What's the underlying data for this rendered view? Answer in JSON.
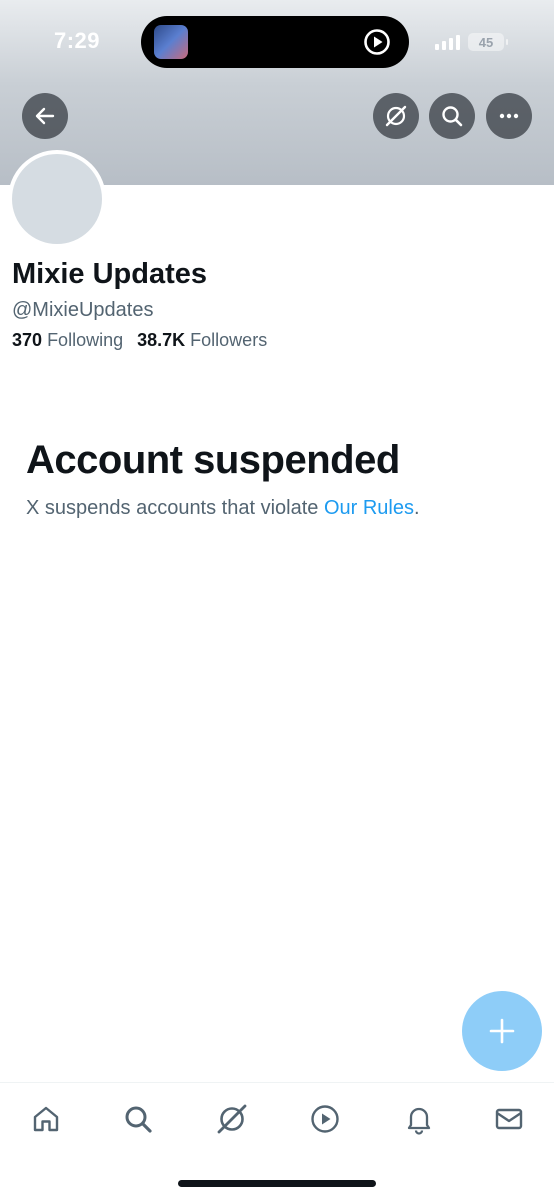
{
  "status_bar": {
    "time": "7:29",
    "battery": "45",
    "signal_bars": 4
  },
  "header": {
    "back_icon": "arrow-left-icon",
    "grok_icon": "grok-icon",
    "search_icon": "search-icon",
    "more_icon": "more-dots-icon"
  },
  "profile": {
    "name": "Mixie Updates",
    "handle": "@MixieUpdates",
    "following_count": "370",
    "following_label": "Following",
    "followers_count": "38.7K",
    "followers_label": "Followers"
  },
  "notice": {
    "title": "Account suspended",
    "text": "X suspends accounts that violate ",
    "link": "Our Rules",
    "suffix": "."
  },
  "fab": {
    "icon": "plus-icon"
  },
  "bottom_nav": [
    {
      "icon": "home-icon"
    },
    {
      "icon": "search-icon"
    },
    {
      "icon": "grok-icon"
    },
    {
      "icon": "video-play-icon"
    },
    {
      "icon": "bell-icon"
    },
    {
      "icon": "mail-icon"
    }
  ],
  "colors": {
    "accent": "#1d9bf0",
    "fab": "#8ecdf8",
    "text_primary": "#0f1419",
    "text_secondary": "#536471"
  }
}
